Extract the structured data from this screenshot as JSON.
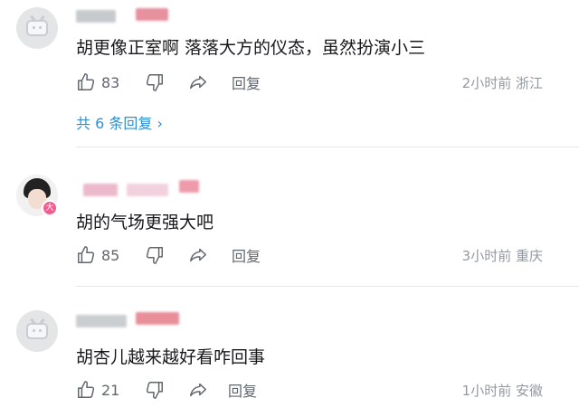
{
  "comments": [
    {
      "username_blurred": true,
      "text": "胡更像正室啊 落落大方的仪态，虽然扮演小三",
      "likes": "83",
      "reply_label": "回复",
      "time_ago": "2小时前",
      "location": "浙江",
      "replies_link": "共 6 条回复 ›",
      "avatar_type": "default-tv"
    },
    {
      "username_blurred": true,
      "text": "胡的气场更强大吧",
      "likes": "85",
      "reply_label": "回复",
      "time_ago": "3小时前",
      "location": "重庆",
      "avatar_type": "photo",
      "badge": "大"
    },
    {
      "username_blurred": true,
      "text": "胡杏儿越来越好看咋回事",
      "likes": "21",
      "reply_label": "回复",
      "time_ago": "1小时前",
      "location": "安徽",
      "avatar_type": "default-tv"
    }
  ],
  "colors": {
    "text": "#18191c",
    "muted": "#9499a0",
    "link": "#2f8fcf",
    "divider": "#e3e5e7",
    "badge": "#f25d8e"
  }
}
